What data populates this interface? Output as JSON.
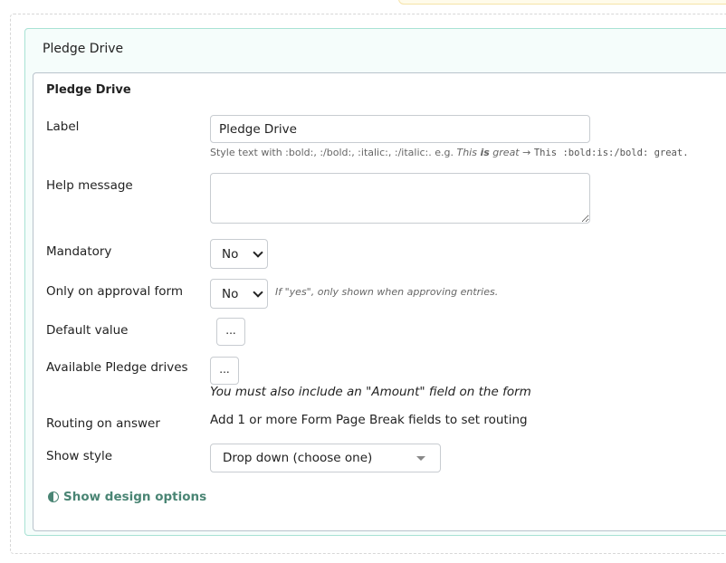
{
  "panel": {
    "title": "Pledge Drive"
  },
  "field": {
    "title": "Pledge Drive",
    "label": {
      "label": "Label",
      "value": "Pledge Drive"
    },
    "hint": {
      "prefix": "Style text with :bold:, :/bold:, :italic:, :/italic:. e.g. ",
      "ex_this": "This ",
      "ex_is": "is",
      "ex_great": " great",
      "arrow": " → ",
      "code": "This :bold:is:/bold: great."
    },
    "help_message": {
      "label": "Help message",
      "value": ""
    },
    "mandatory": {
      "label": "Mandatory",
      "value": "No"
    },
    "approval": {
      "label": "Only on approval form",
      "value": "No",
      "note": "If \"yes\", only shown when approving entries."
    },
    "default_value": {
      "label": "Default value",
      "button": "..."
    },
    "available": {
      "label": "Available Pledge drives",
      "button": "...",
      "note": "You must also include an \"Amount\" field on the form"
    },
    "routing": {
      "label": "Routing on answer",
      "text": "Add 1 or more Form Page Break fields to set routing"
    },
    "show_style": {
      "label": "Show style",
      "value": "Drop down (choose one)"
    },
    "design_link": "Show design options"
  },
  "colors": {
    "accent": "#4a8574",
    "panel_border": "#a8e2d4",
    "panel_bg": "#f5fdfb"
  }
}
